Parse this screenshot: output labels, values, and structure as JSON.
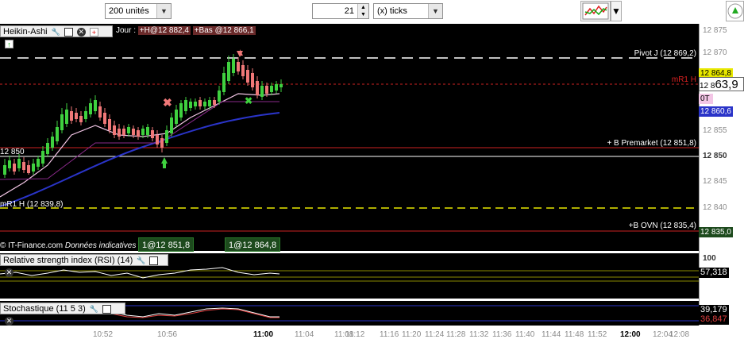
{
  "toolbar": {
    "units_value": "200 unités",
    "ticks_count": "21",
    "ticks_unit": "(x) ticks"
  },
  "main_chart": {
    "title": "Heikin-Ashi",
    "header_info_prefix": "Jour :",
    "header_info_high": "+H@12 882,4",
    "header_info_low": "+Bas @12 866,1",
    "copyright": "© IT-Finance.com",
    "disclaimer": "Données indicatives",
    "chip_left": "1@12 851,8",
    "chip_right": "1@12 864,8",
    "levels": {
      "pivot": "Pivot J (12 869,2)",
      "mr1h_right": "mR1 H",
      "premarket": "+ B Premarket (12 851,8)",
      "left_850": "12 850",
      "mr1h_left": "mR1 H (12 839,8)",
      "ovn": "+B OVN (12 835,4)"
    },
    "price_tags": {
      "yellow": "12 864,8",
      "current_small": "12 8",
      "current_big": "63,9",
      "ot": "0T",
      "blue": "12 860,6",
      "green": "12 835,0"
    },
    "y_ticks": [
      "12 875",
      "12 870",
      "12 865",
      "12 860",
      "12 855",
      "12 850",
      "12 845",
      "12 840",
      "12 835"
    ],
    "colors": {
      "up": "#3fd13f",
      "down": "#f07878",
      "avg_fast": "#f3c6e6",
      "avg_slow": "#2a34c8",
      "support": "#cc2222",
      "pivot_dash": "#ffffff",
      "yellow_dash": "#e8e800"
    }
  },
  "rsi_panel": {
    "title": "Relative strength index (RSI) (14)",
    "value": "57,318",
    "y_tick": "100"
  },
  "stoch_panel": {
    "title": "Stochastique (11 5 3)",
    "value_k": "39,179",
    "value_d": "36,847"
  },
  "x_axis": {
    "ticks": [
      "10:52",
      "10:56",
      "11:00",
      "11:04",
      "11:08",
      "11:12",
      "11:16",
      "11:20",
      "11:24",
      "11:28",
      "11:32",
      "11:36",
      "11:40",
      "11:44",
      "11:48",
      "11:52",
      "12:00",
      "12:04",
      "12:08"
    ]
  }
}
